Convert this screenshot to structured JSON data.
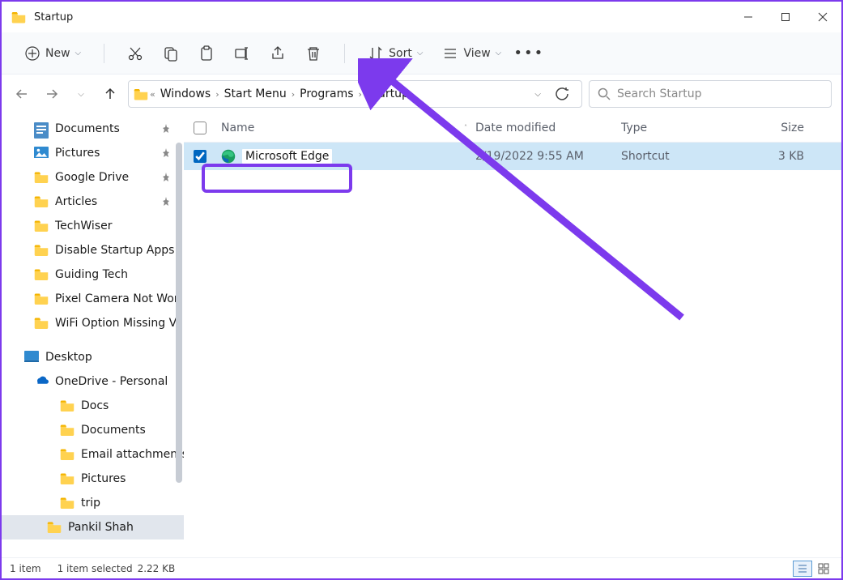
{
  "window": {
    "title": "Startup"
  },
  "toolbar": {
    "new_label": "New",
    "sort_label": "Sort",
    "view_label": "View"
  },
  "breadcrumb": {
    "items": [
      "Windows",
      "Start Menu",
      "Programs",
      "Startup"
    ]
  },
  "search": {
    "placeholder": "Search Startup"
  },
  "sidebar": {
    "quick": [
      {
        "icon": "doc",
        "label": "Documents",
        "pinned": true
      },
      {
        "icon": "pic",
        "label": "Pictures",
        "pinned": true
      },
      {
        "icon": "folder",
        "label": "Google Drive",
        "pinned": true
      },
      {
        "icon": "folder",
        "label": "Articles",
        "pinned": true
      },
      {
        "icon": "folder",
        "label": "TechWiser"
      },
      {
        "icon": "folder",
        "label": "Disable Startup Apps"
      },
      {
        "icon": "folder",
        "label": "Guiding Tech"
      },
      {
        "icon": "folder",
        "label": "Pixel Camera Not Wor"
      },
      {
        "icon": "folder",
        "label": "WiFi Option Missing V"
      }
    ],
    "desktop_label": "Desktop",
    "onedrive_label": "OneDrive - Personal",
    "onedrive": [
      {
        "label": "Docs"
      },
      {
        "label": "Documents"
      },
      {
        "label": "Email attachments"
      },
      {
        "label": "Pictures"
      },
      {
        "label": "trip"
      }
    ],
    "selected_label": "Pankil Shah"
  },
  "columns": {
    "name": "Name",
    "date": "Date modified",
    "type": "Type",
    "size": "Size"
  },
  "files": [
    {
      "name": "Microsoft Edge",
      "date": "2/19/2022 9:55 AM",
      "type": "Shortcut",
      "size": "3 KB",
      "checked": true
    }
  ],
  "statusbar": {
    "count": "1 item",
    "selected": "1 item selected",
    "size": "2.22 KB"
  }
}
